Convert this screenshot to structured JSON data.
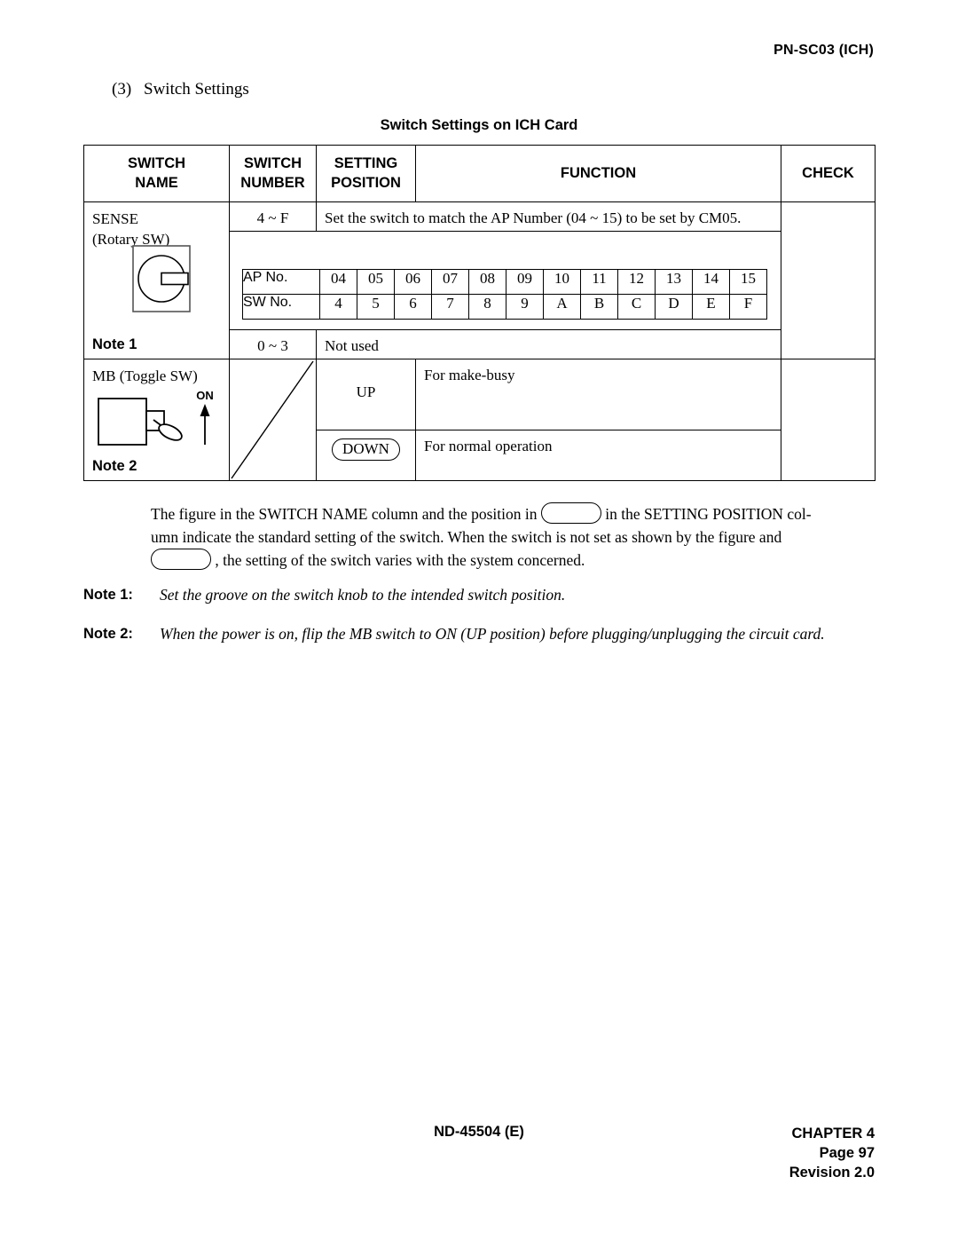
{
  "header": {
    "card_id": "PN-SC03 (ICH)"
  },
  "section": {
    "number": "(3)",
    "title": "Switch Settings"
  },
  "table": {
    "caption": "Switch Settings on ICH Card",
    "columns": [
      {
        "line1": "SWITCH",
        "line2": "NAME"
      },
      {
        "line1": "SWITCH",
        "line2": "NUMBER"
      },
      {
        "line1": "SETTING",
        "line2": "POSITION"
      },
      {
        "line1": "FUNCTION",
        "line2": ""
      },
      {
        "line1": "CHECK",
        "line2": ""
      }
    ],
    "rows": {
      "sense": {
        "name_line1": "SENSE",
        "name_line2": "(Rotary SW)",
        "note_label": "Note 1",
        "switch_icon": "rotary-switch-icon",
        "number_1": "4 ~ F",
        "function_1": "Set the switch to match the AP Number (04 ~ 15) to be set by CM05.",
        "number_2": "0 ~ 3",
        "function_2": "Not used",
        "check": ""
      },
      "mb": {
        "name_line1": "MB (Toggle SW)",
        "note_label": "Note 2",
        "switch_icon": "toggle-switch-icon",
        "on_label": "ON",
        "number": "",
        "position_up": "UP",
        "function_up": "For make-busy",
        "position_down": "DOWN",
        "function_down": "For normal operation",
        "check": ""
      }
    }
  },
  "ap_table": {
    "row_headers": [
      "AP No.",
      "SW No."
    ],
    "ap_numbers": [
      "04",
      "05",
      "06",
      "07",
      "08",
      "09",
      "10",
      "11",
      "12",
      "13",
      "14",
      "15"
    ],
    "sw_numbers": [
      "4",
      "5",
      "6",
      "7",
      "8",
      "9",
      "A",
      "B",
      "C",
      "D",
      "E",
      "F"
    ]
  },
  "explanation": {
    "line1_a": "The figure in the SWITCH NAME column and the position in",
    "line1_b": "in the SETTING POSITION col-",
    "line2": "umn indicate the standard setting of the switch. When the switch is not set as shown by the figure and",
    "line3": ", the setting of the switch varies with the system concerned."
  },
  "notes": [
    {
      "label": "Note 1:",
      "text": "Set the groove on the switch knob to the intended switch position."
    },
    {
      "label": "Note 2:",
      "text": "When the power is on, flip the MB switch to ON (UP position) before plugging/unplugging the circuit card."
    }
  ],
  "footer": {
    "document_id": "ND-45504 (E)",
    "chapter": "CHAPTER 4",
    "page": "Page 97",
    "revision": "Revision 2.0"
  },
  "colors": {
    "text": "#000000",
    "rule": "#000000",
    "background": "#ffffff"
  }
}
